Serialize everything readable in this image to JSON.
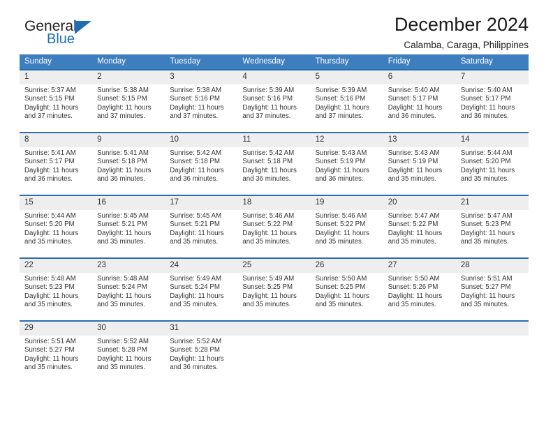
{
  "brand": {
    "name_top": "General",
    "name_bottom": "Blue",
    "accent_color": "#1f6eb4"
  },
  "header": {
    "title": "December 2024",
    "location": "Calamba, Caraga, Philippines"
  },
  "theme": {
    "header_blue": "#3d7ebf",
    "row_border_blue": "#2a6db0",
    "daynum_bg": "#eeeeee",
    "text": "#333333"
  },
  "columns": [
    "Sunday",
    "Monday",
    "Tuesday",
    "Wednesday",
    "Thursday",
    "Friday",
    "Saturday"
  ],
  "labels": {
    "sunrise": "Sunrise:",
    "sunset": "Sunset:",
    "daylight": "Daylight:"
  },
  "weeks": [
    [
      {
        "day": "1",
        "sunrise": "Sunrise: 5:37 AM",
        "sunset": "Sunset: 5:15 PM",
        "daylight": "Daylight: 11 hours and 37 minutes."
      },
      {
        "day": "2",
        "sunrise": "Sunrise: 5:38 AM",
        "sunset": "Sunset: 5:15 PM",
        "daylight": "Daylight: 11 hours and 37 minutes."
      },
      {
        "day": "3",
        "sunrise": "Sunrise: 5:38 AM",
        "sunset": "Sunset: 5:16 PM",
        "daylight": "Daylight: 11 hours and 37 minutes."
      },
      {
        "day": "4",
        "sunrise": "Sunrise: 5:39 AM",
        "sunset": "Sunset: 5:16 PM",
        "daylight": "Daylight: 11 hours and 37 minutes."
      },
      {
        "day": "5",
        "sunrise": "Sunrise: 5:39 AM",
        "sunset": "Sunset: 5:16 PM",
        "daylight": "Daylight: 11 hours and 37 minutes."
      },
      {
        "day": "6",
        "sunrise": "Sunrise: 5:40 AM",
        "sunset": "Sunset: 5:17 PM",
        "daylight": "Daylight: 11 hours and 36 minutes."
      },
      {
        "day": "7",
        "sunrise": "Sunrise: 5:40 AM",
        "sunset": "Sunset: 5:17 PM",
        "daylight": "Daylight: 11 hours and 36 minutes."
      }
    ],
    [
      {
        "day": "8",
        "sunrise": "Sunrise: 5:41 AM",
        "sunset": "Sunset: 5:17 PM",
        "daylight": "Daylight: 11 hours and 36 minutes."
      },
      {
        "day": "9",
        "sunrise": "Sunrise: 5:41 AM",
        "sunset": "Sunset: 5:18 PM",
        "daylight": "Daylight: 11 hours and 36 minutes."
      },
      {
        "day": "10",
        "sunrise": "Sunrise: 5:42 AM",
        "sunset": "Sunset: 5:18 PM",
        "daylight": "Daylight: 11 hours and 36 minutes."
      },
      {
        "day": "11",
        "sunrise": "Sunrise: 5:42 AM",
        "sunset": "Sunset: 5:18 PM",
        "daylight": "Daylight: 11 hours and 36 minutes."
      },
      {
        "day": "12",
        "sunrise": "Sunrise: 5:43 AM",
        "sunset": "Sunset: 5:19 PM",
        "daylight": "Daylight: 11 hours and 36 minutes."
      },
      {
        "day": "13",
        "sunrise": "Sunrise: 5:43 AM",
        "sunset": "Sunset: 5:19 PM",
        "daylight": "Daylight: 11 hours and 35 minutes."
      },
      {
        "day": "14",
        "sunrise": "Sunrise: 5:44 AM",
        "sunset": "Sunset: 5:20 PM",
        "daylight": "Daylight: 11 hours and 35 minutes."
      }
    ],
    [
      {
        "day": "15",
        "sunrise": "Sunrise: 5:44 AM",
        "sunset": "Sunset: 5:20 PM",
        "daylight": "Daylight: 11 hours and 35 minutes."
      },
      {
        "day": "16",
        "sunrise": "Sunrise: 5:45 AM",
        "sunset": "Sunset: 5:21 PM",
        "daylight": "Daylight: 11 hours and 35 minutes."
      },
      {
        "day": "17",
        "sunrise": "Sunrise: 5:45 AM",
        "sunset": "Sunset: 5:21 PM",
        "daylight": "Daylight: 11 hours and 35 minutes."
      },
      {
        "day": "18",
        "sunrise": "Sunrise: 5:46 AM",
        "sunset": "Sunset: 5:22 PM",
        "daylight": "Daylight: 11 hours and 35 minutes."
      },
      {
        "day": "19",
        "sunrise": "Sunrise: 5:46 AM",
        "sunset": "Sunset: 5:22 PM",
        "daylight": "Daylight: 11 hours and 35 minutes."
      },
      {
        "day": "20",
        "sunrise": "Sunrise: 5:47 AM",
        "sunset": "Sunset: 5:22 PM",
        "daylight": "Daylight: 11 hours and 35 minutes."
      },
      {
        "day": "21",
        "sunrise": "Sunrise: 5:47 AM",
        "sunset": "Sunset: 5:23 PM",
        "daylight": "Daylight: 11 hours and 35 minutes."
      }
    ],
    [
      {
        "day": "22",
        "sunrise": "Sunrise: 5:48 AM",
        "sunset": "Sunset: 5:23 PM",
        "daylight": "Daylight: 11 hours and 35 minutes."
      },
      {
        "day": "23",
        "sunrise": "Sunrise: 5:48 AM",
        "sunset": "Sunset: 5:24 PM",
        "daylight": "Daylight: 11 hours and 35 minutes."
      },
      {
        "day": "24",
        "sunrise": "Sunrise: 5:49 AM",
        "sunset": "Sunset: 5:24 PM",
        "daylight": "Daylight: 11 hours and 35 minutes."
      },
      {
        "day": "25",
        "sunrise": "Sunrise: 5:49 AM",
        "sunset": "Sunset: 5:25 PM",
        "daylight": "Daylight: 11 hours and 35 minutes."
      },
      {
        "day": "26",
        "sunrise": "Sunrise: 5:50 AM",
        "sunset": "Sunset: 5:25 PM",
        "daylight": "Daylight: 11 hours and 35 minutes."
      },
      {
        "day": "27",
        "sunrise": "Sunrise: 5:50 AM",
        "sunset": "Sunset: 5:26 PM",
        "daylight": "Daylight: 11 hours and 35 minutes."
      },
      {
        "day": "28",
        "sunrise": "Sunrise: 5:51 AM",
        "sunset": "Sunset: 5:27 PM",
        "daylight": "Daylight: 11 hours and 35 minutes."
      }
    ],
    [
      {
        "day": "29",
        "sunrise": "Sunrise: 5:51 AM",
        "sunset": "Sunset: 5:27 PM",
        "daylight": "Daylight: 11 hours and 35 minutes."
      },
      {
        "day": "30",
        "sunrise": "Sunrise: 5:52 AM",
        "sunset": "Sunset: 5:28 PM",
        "daylight": "Daylight: 11 hours and 35 minutes."
      },
      {
        "day": "31",
        "sunrise": "Sunrise: 5:52 AM",
        "sunset": "Sunset: 5:28 PM",
        "daylight": "Daylight: 11 hours and 36 minutes."
      },
      {
        "day": "",
        "sunrise": "",
        "sunset": "",
        "daylight": ""
      },
      {
        "day": "",
        "sunrise": "",
        "sunset": "",
        "daylight": ""
      },
      {
        "day": "",
        "sunrise": "",
        "sunset": "",
        "daylight": ""
      },
      {
        "day": "",
        "sunrise": "",
        "sunset": "",
        "daylight": ""
      }
    ]
  ]
}
